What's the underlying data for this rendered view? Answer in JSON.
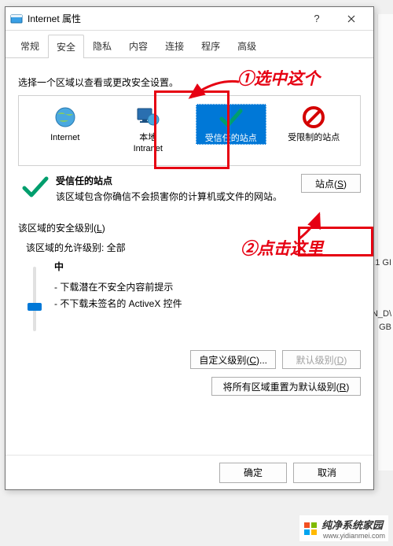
{
  "window": {
    "title": "Internet 属性"
  },
  "tabs": {
    "items": [
      {
        "label": "常规"
      },
      {
        "label": "安全"
      },
      {
        "label": "隐私"
      },
      {
        "label": "内容"
      },
      {
        "label": "连接"
      },
      {
        "label": "程序"
      },
      {
        "label": "高级"
      }
    ],
    "active": 1
  },
  "zone_select_label": "选择一个区域以查看或更改安全设置。",
  "zones": {
    "items": [
      {
        "label": "Internet"
      },
      {
        "label": "本地\nIntranet"
      },
      {
        "label": "受信任的站点"
      },
      {
        "label": "受限制的站点"
      }
    ],
    "selected": 2
  },
  "zone_desc": {
    "title": "受信任的站点",
    "body": "该区域包含你确信不会损害你的计算机或文件的网站。"
  },
  "sites_btn": "站点(S)",
  "sec": {
    "heading": "该区域的安全级别(L)",
    "allow": "该区域的允许级别: 全部",
    "level": "中",
    "bullet1": "- 下载潜在不安全内容前提示",
    "bullet2": "- 不下载未签名的 ActiveX 控件"
  },
  "buttons": {
    "custom": "自定义级别(C)...",
    "default": "默认级别(D)",
    "reset": "将所有区域重置为默认级别(R)"
  },
  "footer": {
    "ok": "确定",
    "cancel": "取消"
  },
  "annotations": {
    "a1": "①选中这个",
    "a2": "②点击这里"
  },
  "background": {
    "t1": ".1 GI",
    "t2": "N_D\\",
    "t3": "GB"
  },
  "watermark": {
    "brand": "纯净系统家园",
    "url": "www.yidianmei.com"
  },
  "accent": "#e60012"
}
